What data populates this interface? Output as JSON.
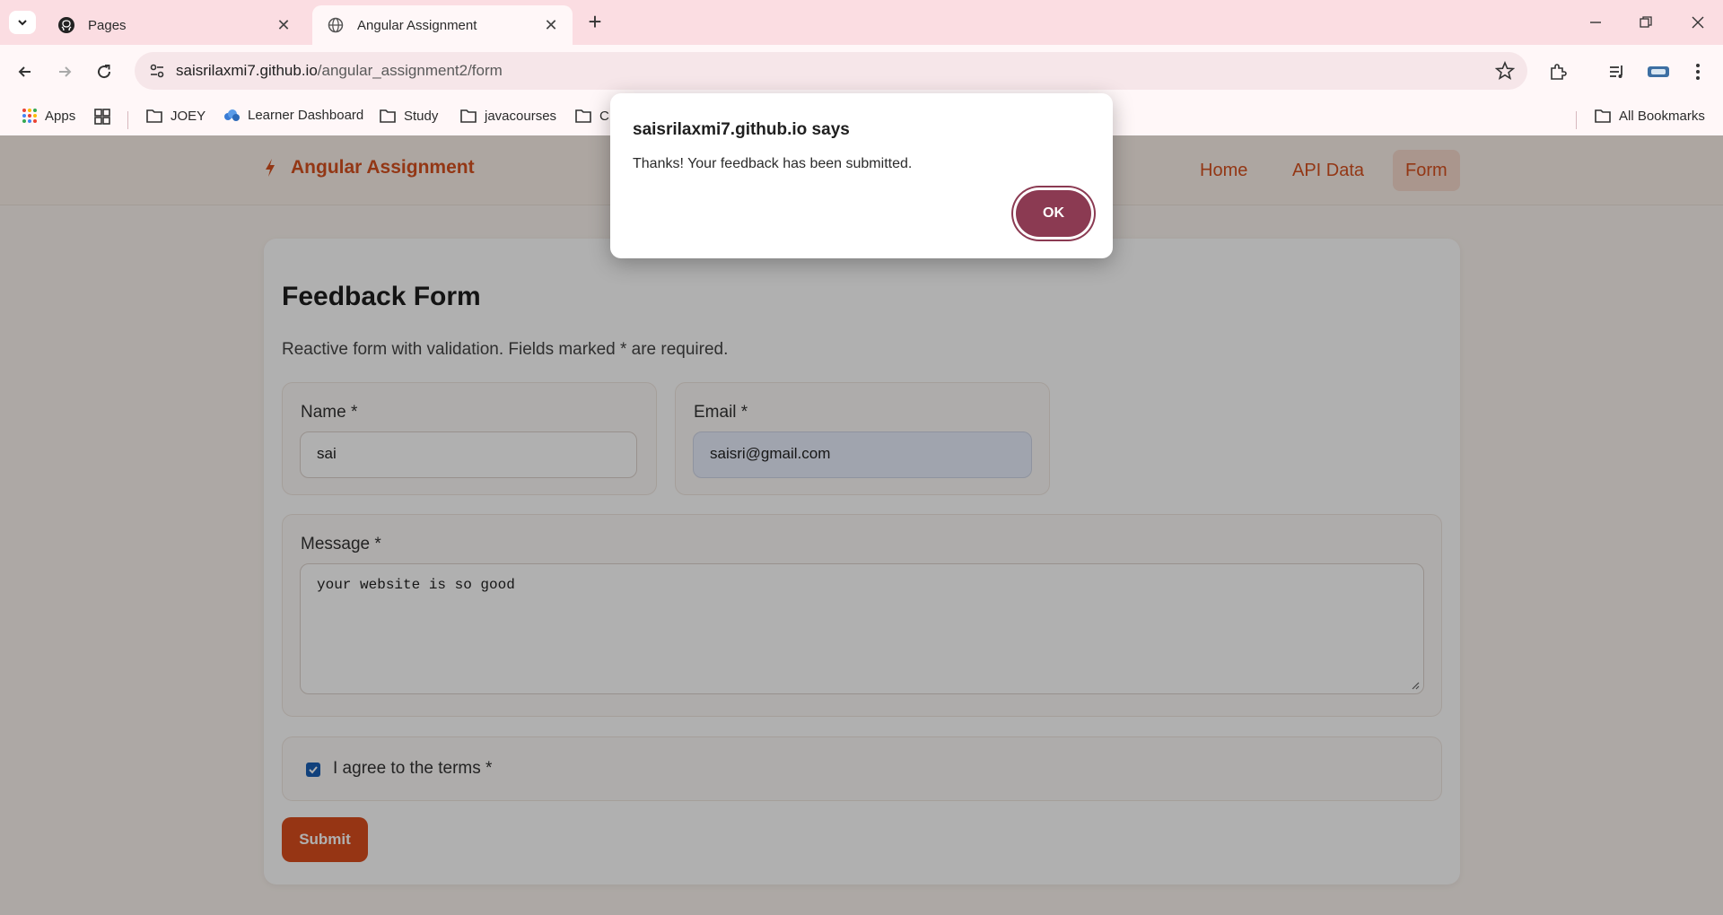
{
  "browser": {
    "tabs": [
      {
        "title": "Pages",
        "favicon": "github-icon",
        "active": false
      },
      {
        "title": "Angular Assignment",
        "favicon": "globe-icon",
        "active": true
      }
    ],
    "url": {
      "host": "saisrilaxmi7.github.io",
      "path": "/angular_assignment2/form"
    },
    "bookmarks": [
      {
        "label": "Apps",
        "icon": "apps-grid-icon"
      },
      {
        "label": "",
        "icon": "tab-groups-icon"
      },
      {
        "label": "JOEY",
        "icon": "folder-icon"
      },
      {
        "label": "Learner Dashboard",
        "icon": "learner-dashboard-icon"
      },
      {
        "label": "Study",
        "icon": "folder-icon"
      },
      {
        "label": "javacourses",
        "icon": "folder-icon"
      },
      {
        "label": "C",
        "icon": "folder-icon"
      }
    ],
    "all_bookmarks": "All Bookmarks"
  },
  "app": {
    "brand": "Angular Assignment",
    "nav": [
      {
        "label": "Home",
        "active": false
      },
      {
        "label": "API Data",
        "active": false
      },
      {
        "label": "Form",
        "active": true
      }
    ]
  },
  "form": {
    "title": "Feedback Form",
    "subtitle": "Reactive form with validation. Fields marked * are required.",
    "name": {
      "label": "Name *",
      "value": "sai"
    },
    "email": {
      "label": "Email *",
      "value": "saisri@gmail.com"
    },
    "message": {
      "label": "Message *",
      "value": "your website is so good"
    },
    "agree": {
      "label": "I agree to the terms *",
      "checked": true
    },
    "submit_label": "Submit"
  },
  "dialog": {
    "title": "saisrilaxmi7.github.io says",
    "message": "Thanks! Your feedback has been submitted.",
    "ok_label": "OK"
  },
  "colors": {
    "accent": "#d5501f",
    "dialog_button": "#8b3a52",
    "tabbar": "#fbdde2"
  }
}
